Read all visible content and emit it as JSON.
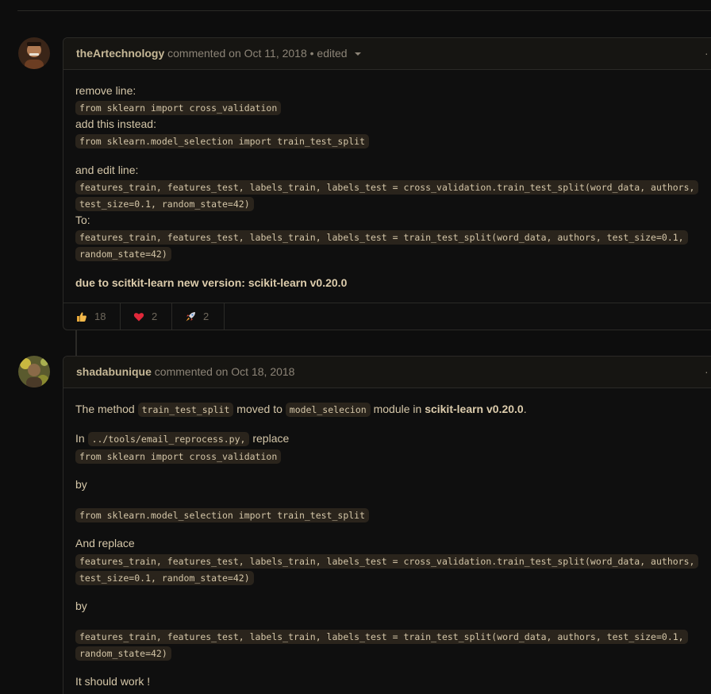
{
  "comments": [
    {
      "author": "theArtechnology",
      "meta": "commented on Oct 11, 2018 • edited",
      "kebab": "·",
      "lines": {
        "l1": "remove line:",
        "c1": "from sklearn import cross_validation",
        "l2": "add this instead:",
        "c2": "from sklearn.model_selection import train_test_split",
        "l3": "and edit line:",
        "c3a": "features_train, features_test, labels_train, labels_test = cross_validation.train_test_split(word_data, authors,",
        "c3b": "test_size=0.1, random_state=42)",
        "l4": "To:",
        "c4a": "features_train, features_test, labels_train, labels_test = train_test_split(word_data, authors, test_size=0.1,",
        "c4b": "random_state=42)",
        "l5": "due to scitkit-learn new version: scikit-learn v0.20.0"
      },
      "reactions": [
        {
          "icon": "thumbs-up-icon",
          "count": "18"
        },
        {
          "icon": "heart-icon",
          "count": "2"
        },
        {
          "icon": "rocket-icon",
          "count": "2"
        }
      ]
    },
    {
      "author": "shadabunique",
      "meta": "commented on Oct 18, 2018",
      "kebab": "·",
      "lines": {
        "p1_pre": "The method",
        "p1_code1": "train_test_split",
        "p1_mid": "moved to",
        "p1_code2": "model_selecion",
        "p1_post": "module in",
        "p1_strong": "scikit-learn v0.20.0",
        "p1_end": ".",
        "p2_pre": "In",
        "p2_code": "../tools/email_reprocess.py,",
        "p2_post": "replace",
        "c1": "from sklearn import cross_validation",
        "by1": "by",
        "c2": "from sklearn.model_selection import train_test_split",
        "p3": "And replace",
        "c3a": "features_train, features_test, labels_train, labels_test = cross_validation.train_test_split(word_data, authors,",
        "c3b": "test_size=0.1, random_state=42)",
        "by2": "by",
        "c4a": "features_train, features_test, labels_train, labels_test = train_test_split(word_data, authors, test_size=0.1,",
        "c4b": "random_state=42)",
        "p4": "It should work !"
      }
    }
  ]
}
